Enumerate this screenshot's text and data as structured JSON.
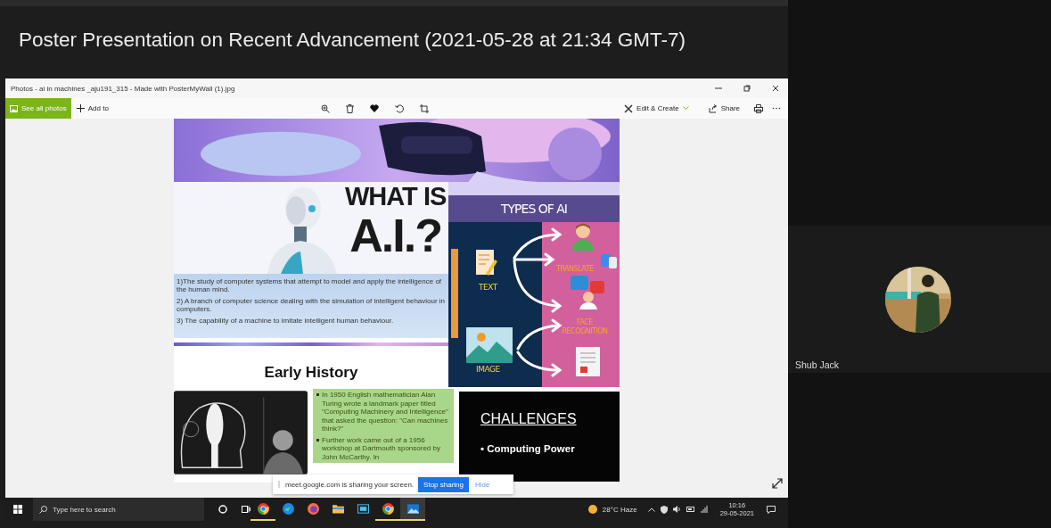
{
  "meeting": {
    "title": "Poster Presentation on Recent Advancement (2021-05-28 at 21:34 GMT-7)",
    "participants": [
      {
        "name": "Shub Jack"
      }
    ]
  },
  "photos_window": {
    "title": "Photos - ai in machines _aju191_315 - Made with PosterMyWall (1).jpg",
    "see_all": "See all photos",
    "add_to": "Add to",
    "edit_create": "Edit & Create",
    "share": "Share"
  },
  "poster": {
    "heading_1": "WHAT IS",
    "heading_2": "A.I.?",
    "definitions": [
      "1)The study of computer systems that attempt to model and apply the intelligence of the human mind.",
      "2) A branch of computer science dealing with the simulation of intelligent behaviour in computers.",
      "3) The capability of a machine to imitate intelligent human behaviour."
    ],
    "section_title": "Early History",
    "types_panel": {
      "title": "TYPES OF AI",
      "inputs": [
        "TEXT",
        "IMAGE"
      ],
      "outputs": [
        "TRANSLATE",
        "FACE RECOGNITION"
      ]
    },
    "history_points": [
      "In 1950 English mathematician Alan Turing wrote a landmark paper titled \"Computing Machinery and Intelligence\" that asked the question: \"Can machines think?\"",
      "Further work came out of a 1956 workshop at Dartmouth sponsored by John McCarthy.  In"
    ],
    "challenges": {
      "title": "CHALLENGES",
      "items": [
        "• Computing Power"
      ]
    }
  },
  "share_bar": {
    "message": "meet.google.com is sharing your screen.",
    "stop": "Stop sharing",
    "hide": "Hide"
  },
  "taskbar": {
    "search_placeholder": "Type here to search",
    "apps": [
      {
        "kind": "chrome",
        "running": true,
        "selected": false
      },
      {
        "kind": "edge",
        "running": false,
        "selected": false
      },
      {
        "kind": "firefox",
        "running": false,
        "selected": false
      },
      {
        "kind": "folder",
        "running": false,
        "selected": false
      },
      {
        "kind": "window",
        "running": false,
        "selected": false
      },
      {
        "kind": "chrome",
        "running": true,
        "selected": false
      },
      {
        "kind": "photos",
        "running": true,
        "selected": true
      }
    ],
    "weather": "28°C Haze",
    "time": "10:16",
    "date": "29-05-2021"
  }
}
